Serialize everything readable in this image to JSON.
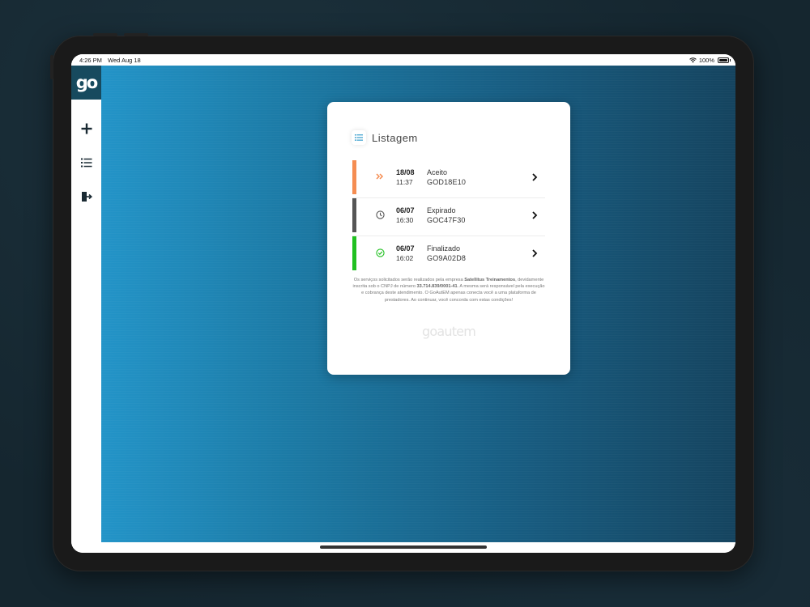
{
  "status_bar": {
    "time": "4:26 PM",
    "date": "Wed Aug 18",
    "battery": "100%",
    "battery_level": 1.0
  },
  "sidebar": {
    "logo": "go",
    "items": [
      {
        "icon": "plus-icon"
      },
      {
        "icon": "list-icon"
      },
      {
        "icon": "logout-icon"
      }
    ]
  },
  "card": {
    "title": "Listagem",
    "items": [
      {
        "date": "18/08",
        "time": "11:37",
        "status": "Aceito",
        "code": "GOD18E10",
        "color": "#f58d52",
        "icon": "double-chevron-icon"
      },
      {
        "date": "06/07",
        "time": "16:30",
        "status": "Expirado",
        "code": "GOC47F30",
        "color": "#555555",
        "icon": "clock-icon"
      },
      {
        "date": "06/07",
        "time": "16:02",
        "status": "Finalizado",
        "code": "GO9A02D8",
        "color": "#20c020",
        "icon": "check-circle-icon"
      }
    ],
    "disclaimer": {
      "p1": "Os serviços solicitados serão realizados pela empresa ",
      "company": "Satellitus Treinamentos",
      "p2": ", devidamente inscrita sob o CNPJ de número ",
      "cnpj": "33.714.839/0001-41",
      "p3": ". A mesma será responsável pela execução e cobrança deste atendimento. O GoAutEM apenas conecta você a uma plataforma de prestadores. Ao continuar, você concorda com estas condições!"
    },
    "footer_logo": "goautem"
  },
  "colors": {
    "accent": "#2394c8",
    "logo_bg": "#174a5e"
  }
}
